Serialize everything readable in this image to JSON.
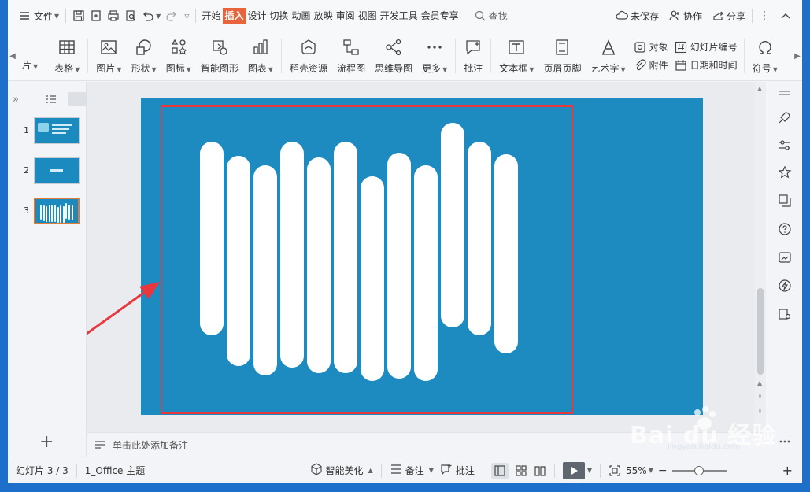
{
  "menubar": {
    "file_label": "文件",
    "tabs": [
      "开始",
      "插入",
      "设计",
      "切换",
      "动画",
      "放映",
      "审阅",
      "视图",
      "开发工具",
      "会员专享"
    ],
    "active_tab": "插入",
    "search_label": "查找",
    "unsaved_label": "未保存",
    "collab_label": "协作",
    "share_label": "分享"
  },
  "ribbon": {
    "partial_label": "片",
    "table": "表格",
    "picture": "图片",
    "shape": "形状",
    "icons": "图标",
    "smart_graphic": "智能图形",
    "chart": "图表",
    "docer": "稻壳资源",
    "flowchart": "流程图",
    "mindmap": "思维导图",
    "more": "更多",
    "comment": "批注",
    "textbox": "文本框",
    "header_footer": "页眉页脚",
    "wordart": "艺术字",
    "object": "对象",
    "attachment": "附件",
    "slide_number": "幻灯片编号",
    "datetime": "日期和时间",
    "symbol": "符号"
  },
  "slides_panel": {
    "numbers": [
      "1",
      "2",
      "3"
    ],
    "active_index": 3
  },
  "slide_bars": [
    0.72,
    0.78,
    0.78,
    0.84,
    0.8,
    0.86,
    0.76,
    0.84,
    0.8,
    0.76,
    0.72,
    0.74
  ],
  "notes_placeholder": "单击此处添加备注",
  "status": {
    "slide_counter": "幻灯片 3 / 3",
    "theme": "1_Office 主题",
    "beautify": "智能美化",
    "notes": "备注",
    "comment": "批注",
    "zoom": "55%"
  },
  "watermark": {
    "brand": "Bai du 经验",
    "url": "jingyan.baidu.com"
  },
  "colors": {
    "active_tab_bg": "#e8643c",
    "slide_bg": "#1d8bbf",
    "selection_border": "#e8373d",
    "annotation_arrow": "#e8373d",
    "active_thumb_border": "#e07c3a"
  }
}
